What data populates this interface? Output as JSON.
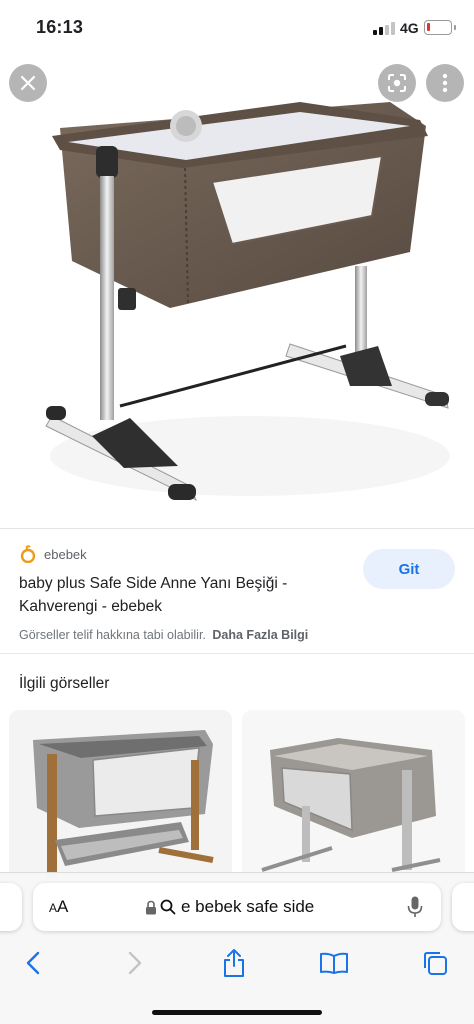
{
  "status_bar": {
    "time": "16:13",
    "network": "4G",
    "battery_level": 0.1
  },
  "viewer": {
    "image_alt": "baby plus Safe Side Anne Yanı Beşiği",
    "close_icon": "close-icon",
    "lens_icon": "lens-icon",
    "more_icon": "more-vert-icon"
  },
  "source": {
    "site_name": "ebebek",
    "title": "baby plus Safe Side Anne Yanı Beşiği - Kahverengi - ebebek",
    "visit_label": "Git",
    "copyright_text": "Görseller telif hakkına tabi olabilir.",
    "more_info_label": "Daha Fazla Bilgi"
  },
  "related": {
    "heading": "İlgili görseller"
  },
  "browser": {
    "aa_label_small": "A",
    "aa_label_large": "A",
    "url": "e bebek safe side",
    "icons": [
      "back-icon",
      "forward-icon",
      "share-icon",
      "bookmarks-icon",
      "tabs-icon",
      "mic-icon",
      "lock-icon",
      "search-icon"
    ]
  },
  "colors": {
    "accent": "#1a73e8",
    "button_bg": "#e8f0fe",
    "crib_fabric": "#6b5a4d"
  }
}
